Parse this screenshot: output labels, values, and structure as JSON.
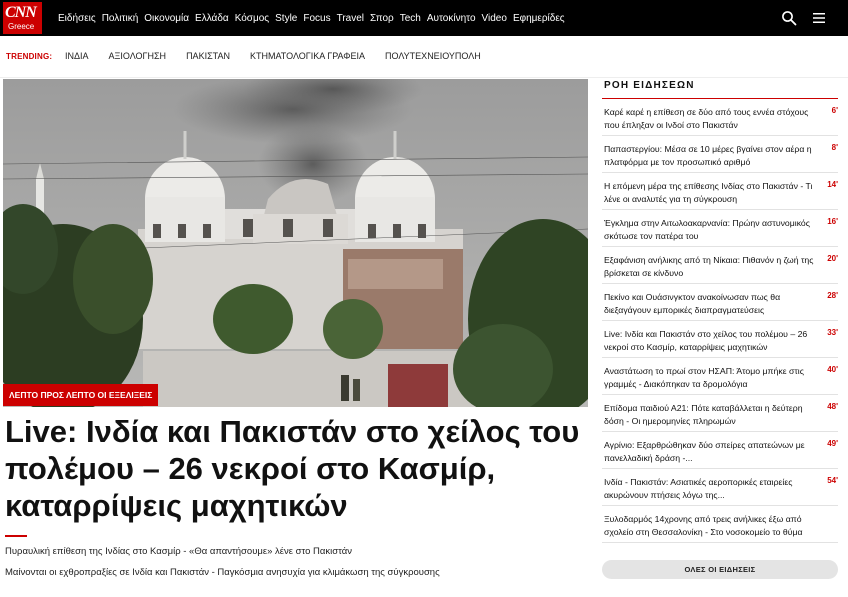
{
  "brand": {
    "logo_text": "CNN",
    "logo_sub": "Greece",
    "accent": "#cc0000"
  },
  "nav": {
    "items": [
      "Ειδήσεις",
      "Πολιτική",
      "Οικονομία",
      "Ελλάδα",
      "Κόσμος",
      "Style",
      "Focus",
      "Travel",
      "Σπορ",
      "Tech",
      "Αυτοκίνητο",
      "Video",
      "Εφημερίδες"
    ],
    "search_icon": "search-icon",
    "menu_icon": "hamburger-menu-icon"
  },
  "trending": {
    "label": "TRENDING:",
    "items": [
      "ΙΝΔΙΑ",
      "ΑΞΙΟΛΟΓΗΣΗ",
      "ΠΑΚΙΣΤΑΝ",
      "ΚΤΗΜΑΤΟΛΟΓΙΚΑ ΓΡΑΦΕΙΑ",
      "ΠΟΛΥΤΕΧΝΕΙΟΥΠΟΛΗ"
    ]
  },
  "hero": {
    "badge": "ΛΕΠΤΟ ΠΡΟΣ ΛΕΠΤΟ ΟΙ ΕΞΕΛΙΞΕΙΣ",
    "headline": "Live: Ινδία και Πακιστάν στο χείλος του πολέμου – 26 νεκροί στο Κασμίρ, καταρρίψεις μαχητικών",
    "related": [
      "Πυραυλική επίθεση της Ινδίας στο Κασμίρ - «Θα απαντήσουμε» λένε στο Πακιστάν",
      "Μαίνονται οι εχθροπραξίες σε Ινδία και Πακιστάν - Παγκόσμια ανησυχία για κλιμάκωση της σύγκρουσης"
    ]
  },
  "feed": {
    "title": "ΡΟΗ ΕΙΔΗΣΕΩΝ",
    "items": [
      {
        "text": "Καρέ καρέ η επίθεση σε δύο από τους εννέα στόχους που έπληξαν οι Ινδοί στο Πακιστάν",
        "age": "6'"
      },
      {
        "text": "Παπαστεργίου: Μέσα σε 10 μέρες βγαίνει στον αέρα η πλατφόρμα με τον προσωπικό αριθμό",
        "age": "8'"
      },
      {
        "text": "Η επόμενη μέρα της επίθεσης Ινδίας στο Πακιστάν - Τι λένε οι αναλυτές για τη σύγκρουση",
        "age": "14'"
      },
      {
        "text": "Έγκλημα στην Αιτωλοακαρνανία: Πρώην αστυνομικός σκότωσε τον πατέρα του",
        "age": "16'"
      },
      {
        "text": "Εξαφάνιση ανήλικης από τη Νίκαια: Πιθανόν η ζωή της βρίσκεται σε κίνδυνο",
        "age": "20'"
      },
      {
        "text": "Πεκίνο και Ουάσινγκτον ανακοίνωσαν πως θα διεξαγάγουν εμπορικές διαπραγματεύσεις",
        "age": "28'"
      },
      {
        "text": "Live: Ινδία και Πακιστάν στο χείλος του πολέμου – 26 νεκροί στο Κασμίρ, καταρρίψεις μαχητικών",
        "age": "33'"
      },
      {
        "text": "Αναστάτωση το πρωί στον ΗΣΑΠ: Άτομο μπήκε στις γραμμές - Διακόπηκαν τα δρομολόγια",
        "age": "40'"
      },
      {
        "text": "Επίδομα παιδιού Α21: Πότε καταβάλλεται η δεύτερη δόση - Οι ημερομηνίες πληρωμών",
        "age": "48'"
      },
      {
        "text": "Αγρίνιο: Εξαρθρώθηκαν δύο σπείρες απατεώνων με πανελλαδική δράση -...",
        "age": "49'"
      },
      {
        "text": "Ινδία - Πακιστάν: Ασιατικές αεροπορικές εταιρείες ακυρώνουν πτήσεις λόγω της...",
        "age": "54'"
      },
      {
        "text": "Ξυλοδαρμός 14χρονης από τρεις ανήλικες έξω από σχολείο στη Θεσσαλονίκη - Στο νοσοκομείο το θύμα",
        "age": ""
      }
    ],
    "all_news_label": "ΟΛΕΣ ΟΙ ΕΙΔΗΣΕΙΣ"
  }
}
